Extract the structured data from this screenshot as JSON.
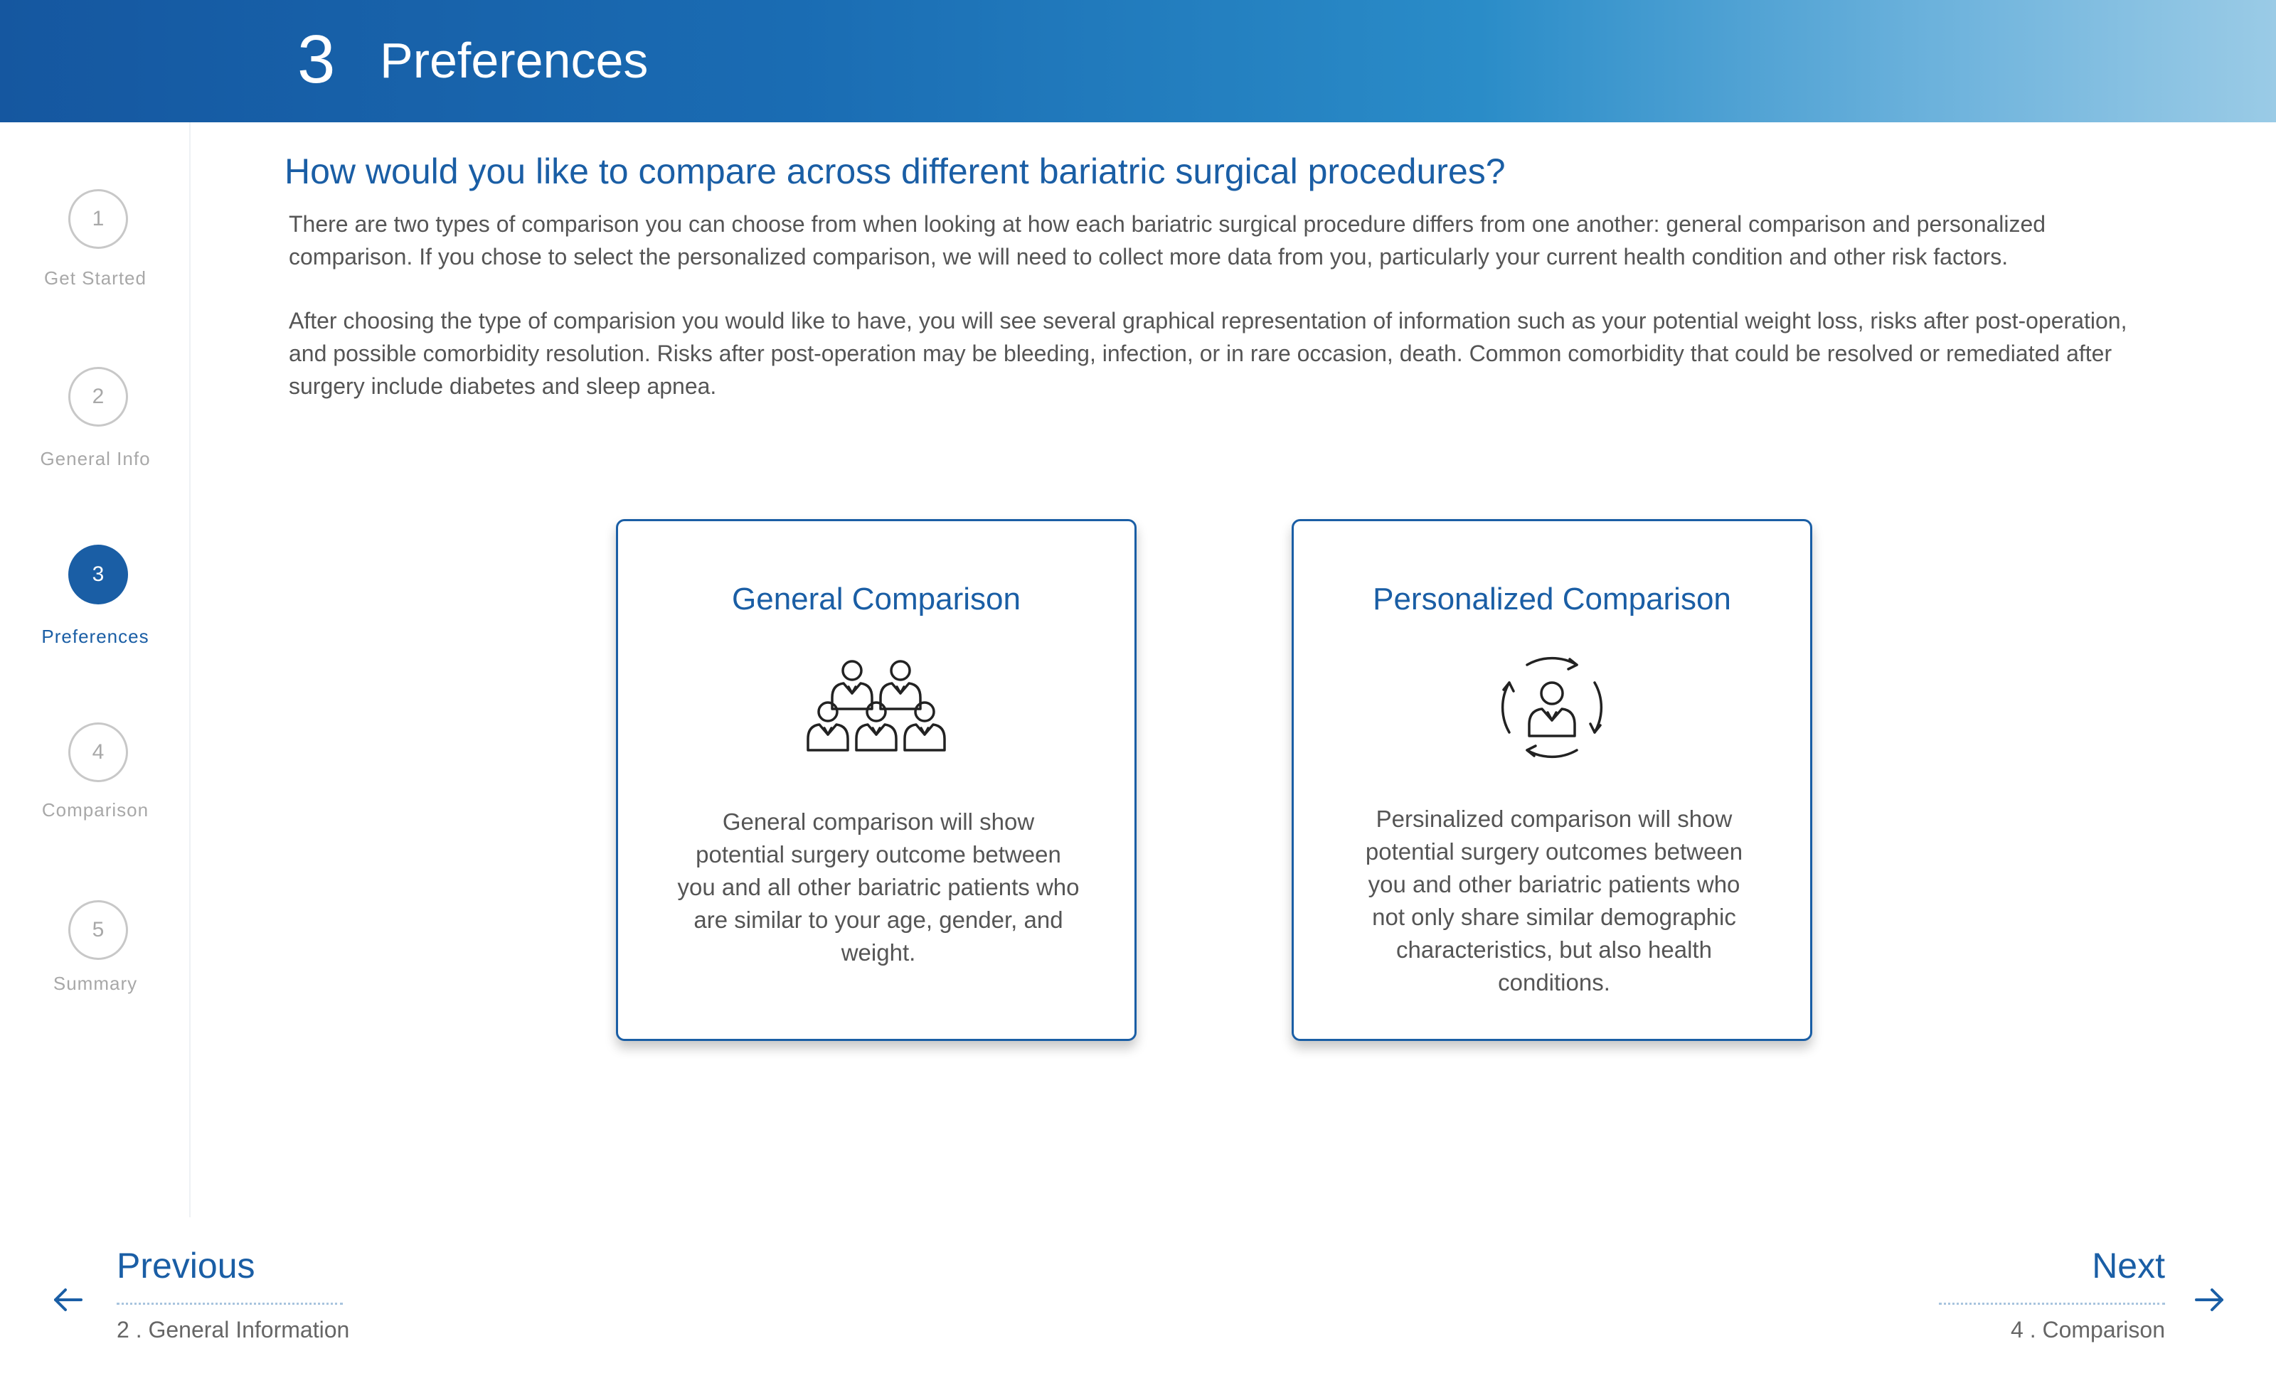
{
  "header": {
    "step_number": "3",
    "title": "Preferences"
  },
  "steps": [
    {
      "number": "1",
      "label": "Get Started",
      "active": false
    },
    {
      "number": "2",
      "label": "General Info",
      "active": false
    },
    {
      "number": "3",
      "label": "Preferences",
      "active": true
    },
    {
      "number": "4",
      "label": "Comparison",
      "active": false
    },
    {
      "number": "5",
      "label": "Summary",
      "active": false
    }
  ],
  "main": {
    "question": "How would you like to compare across different bariatric surgical procedures?",
    "paragraph1": "There are two types of comparison you can choose from when looking at how each bariatric surgical procedure differs from one another: general comparison and personalized comparison. If you chose to select the personalized comparison, we will need to collect more data from you, particularly your current health condition and other risk factors.",
    "paragraph2": "After choosing the type of comparision you would like to have, you will see several graphical representation of information such as your potential weight loss, risks after post-operation, and possible comorbidity resolution. Risks after post-operation may be bleeding, infection, or in rare occasion, death. Common comorbidity that could be resolved or remediated after surgery include diabetes and sleep apnea."
  },
  "cards": {
    "general": {
      "title": "General Comparison",
      "icon": "group-of-people-icon",
      "description": "General comparison will show potential surgery outcome between you and all other bariatric patients who are similar to your age, gender, and weight."
    },
    "personalized": {
      "title": "Personalized Comparison",
      "icon": "person-cycle-icon",
      "description": "Persinalized comparison will show potential surgery outcomes between you and other bariatric patients who not only share similar demographic characteristics, but also health conditions."
    }
  },
  "navigation": {
    "previous": {
      "label": "Previous",
      "target": "2 . General Information",
      "icon": "arrow-left-icon"
    },
    "next": {
      "label": "Next",
      "target": "4 . Comparison",
      "icon": "arrow-right-icon"
    }
  },
  "colors": {
    "accent": "#1a5ea5",
    "header_start": "#1557a0",
    "header_end": "#9acbe6",
    "muted": "#a8a8a8"
  }
}
